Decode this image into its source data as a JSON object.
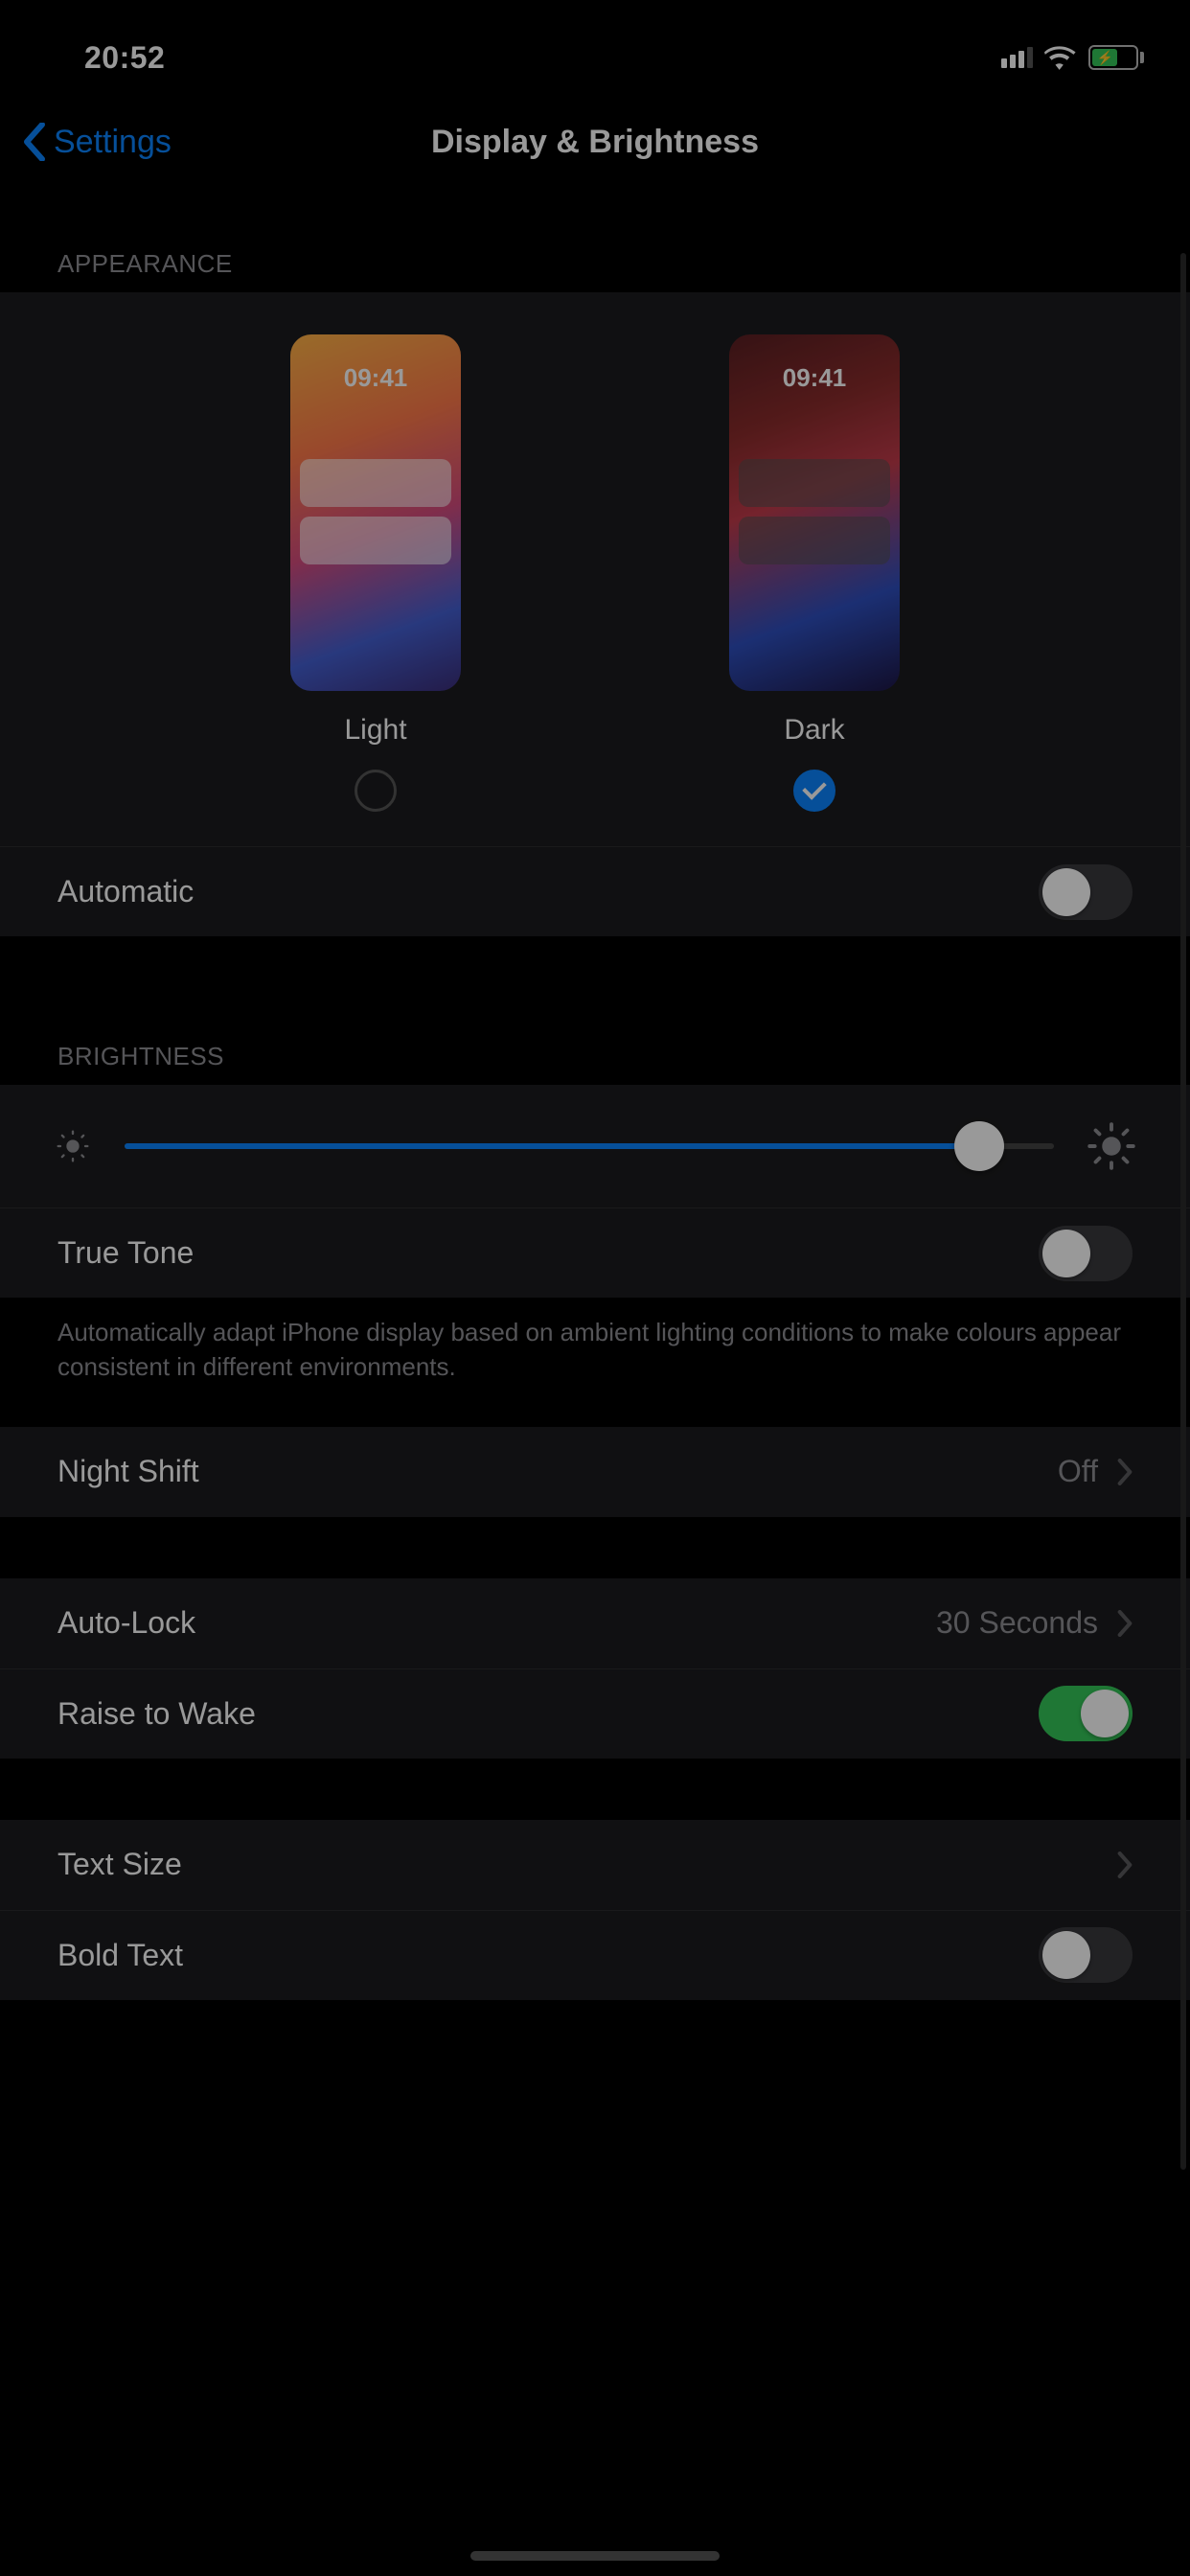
{
  "status": {
    "time": "20:52"
  },
  "nav": {
    "back_label": "Settings",
    "title": "Display & Brightness"
  },
  "appearance": {
    "header": "APPEARANCE",
    "preview_time": "09:41",
    "light_label": "Light",
    "dark_label": "Dark",
    "selected": "dark",
    "automatic_label": "Automatic",
    "automatic_on": false
  },
  "brightness": {
    "header": "BRIGHTNESS",
    "value_percent": 92,
    "true_tone_label": "True Tone",
    "true_tone_on": false,
    "true_tone_desc": "Automatically adapt iPhone display based on ambient lighting conditions to make colours appear consistent in different environments."
  },
  "night_shift": {
    "label": "Night Shift",
    "value": "Off"
  },
  "auto_lock": {
    "label": "Auto-Lock",
    "value": "30 Seconds"
  },
  "raise_to_wake": {
    "label": "Raise to Wake",
    "on": true
  },
  "text_size": {
    "label": "Text Size"
  },
  "bold_text": {
    "label": "Bold Text",
    "on": false
  },
  "colors": {
    "accent": "#0a84ff",
    "green": "#34c759",
    "bg_group": "#1c1c1e",
    "text_secondary": "#8e8e93"
  }
}
